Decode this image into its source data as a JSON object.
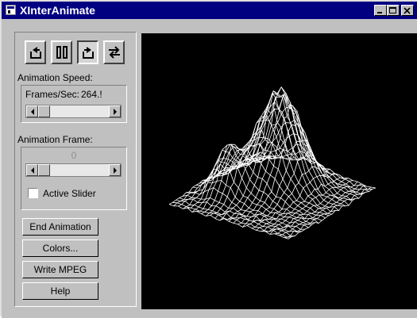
{
  "window": {
    "title": "XInterAnimate"
  },
  "titlebar_buttons": {
    "minimize": "minimize-icon",
    "maximize": "maximize-icon",
    "close": "close-icon"
  },
  "toolbar": {
    "icons": [
      "step-backward-icon",
      "pause-icon",
      "step-forward-icon",
      "bounce-icon"
    ],
    "pressed": "step-forward-icon"
  },
  "speed": {
    "heading": "Animation Speed:",
    "label": "Frames/Sec:",
    "value": "264.!",
    "slider_fraction": 0.0
  },
  "frame": {
    "heading": "Animation Frame:",
    "value": "0",
    "slider_fraction": 0.0,
    "active_slider_label": "Active Slider",
    "active_slider_checked": false
  },
  "buttons": {
    "end": "End Animation",
    "colors": "Colors...",
    "mpeg": "Write MPEG",
    "help": "Help"
  },
  "viewport": {
    "background": "#000000",
    "wireframe_color": "#ffffff"
  }
}
